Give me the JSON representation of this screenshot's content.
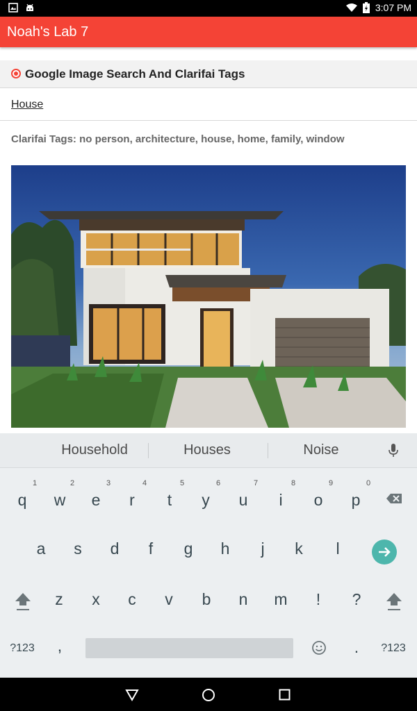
{
  "status_bar": {
    "time": "3:07 PM",
    "icons": [
      "image-notification-icon",
      "android-icon",
      "wifi-icon",
      "battery-charging-icon"
    ]
  },
  "app_bar": {
    "title": "Noah's Lab 7"
  },
  "section": {
    "title": "Google Image Search And Clarifai Tags"
  },
  "query": {
    "text": "House"
  },
  "tags": {
    "text": "Clarifai Tags: no person, architecture, house, home, family, window"
  },
  "photo": {
    "subject": "modern two-story house"
  },
  "keyboard": {
    "suggestions": [
      "Household",
      "Houses",
      "Noise"
    ],
    "row1": [
      "q",
      "w",
      "e",
      "r",
      "t",
      "y",
      "u",
      "i",
      "o",
      "p"
    ],
    "row1_hints": [
      "1",
      "2",
      "3",
      "4",
      "5",
      "6",
      "7",
      "8",
      "9",
      "0"
    ],
    "row2": [
      "a",
      "s",
      "d",
      "f",
      "g",
      "h",
      "j",
      "k",
      "l"
    ],
    "row3": [
      "z",
      "x",
      "c",
      "v",
      "b",
      "n",
      "m",
      "!",
      "?"
    ],
    "symbols_label": "?123",
    "comma": ",",
    "period": "."
  },
  "colors": {
    "accent": "#f44336",
    "enter": "#4db6ac"
  }
}
